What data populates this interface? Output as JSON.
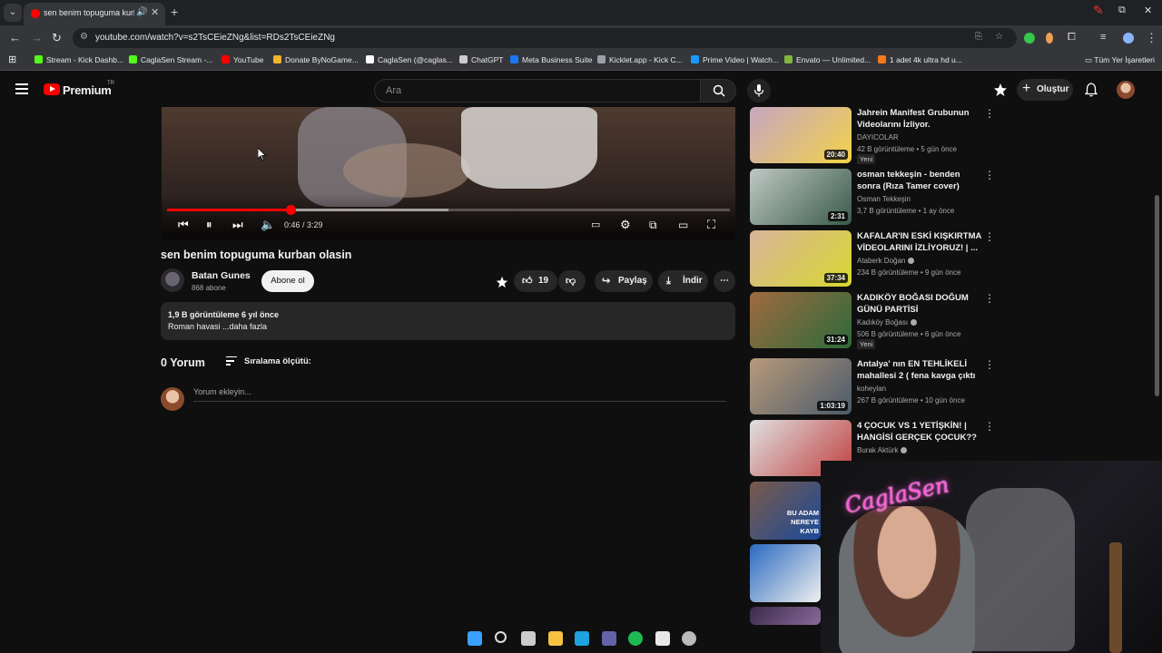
{
  "browser": {
    "tab_title": "sen benim topuguma kurba",
    "url": "youtube.com/watch?v=s2TsCEieZNg&list=RDs2TsCEieZNg",
    "bookmarks": [
      {
        "label": "Stream - Kick Dashb...",
        "color": "#53fc18"
      },
      {
        "label": "CaglaSen Stream -...",
        "color": "#53fc18"
      },
      {
        "label": "YouTube",
        "color": "#ff0000"
      },
      {
        "label": "Donate ByNoGame...",
        "color": "#f0b429"
      },
      {
        "label": "CaglaSen (@caglas...",
        "color": "#ffffff"
      },
      {
        "label": "ChatGPT",
        "color": "#cccccc"
      },
      {
        "label": "Meta Business Suite",
        "color": "#1877f2"
      },
      {
        "label": "Kicklet.app - Kick C...",
        "color": "#9aa0a6"
      },
      {
        "label": "Prime Video | Watch...",
        "color": "#1a98ff"
      },
      {
        "label": "Envato — Unlimited...",
        "color": "#82b541"
      },
      {
        "label": "1 adet 4k ultra hd u...",
        "color": "#f27a1a"
      }
    ],
    "all_bookmarks": "Tüm Yer İşaretleri"
  },
  "header": {
    "logo_text": "Premium",
    "country": "TR",
    "search_placeholder": "Ara",
    "create_label": "Oluştur"
  },
  "player": {
    "time": "0:46 / 3:29",
    "progress": 0.22,
    "buffered": 0.5
  },
  "video": {
    "title": "sen benim topuguma kurban olasin",
    "channel": "Batan Gunes",
    "subscribers": "868 abone",
    "subscribe_label": "Abone ol",
    "likes": "19",
    "share_label": "Paylaş",
    "download_label": "İndir",
    "views_age": "1,9 B görüntüleme  6 yıl önce",
    "description": "Roman havasi ...daha fazla"
  },
  "comments": {
    "count_label": "0 Yorum",
    "sort_label": "Sıralama ölçütü:",
    "placeholder": "Yorum ekleyin..."
  },
  "related": [
    {
      "title": "Jahrein Manifest Grubunun Videolarını İzliyor.",
      "channel": "DAYICOLAR",
      "meta": "42 B görüntüleme • 5 gün önce",
      "duration": "20:40",
      "badge": "Yeni",
      "verified": false,
      "colors": [
        "#c6a6c0",
        "#f2d24a"
      ]
    },
    {
      "title": "osman tekkeşin - benden sonra (Rıza Tamer cover)",
      "channel": "Osman Tekkeşin",
      "meta": "3,7 B görüntüleme • 1 ay önce",
      "duration": "2:31",
      "badge": "",
      "verified": false,
      "colors": [
        "#bfc8c4",
        "#3a5a4a"
      ]
    },
    {
      "title": "KAFALAR'IN ESKİ KIŞKIRTMA VİDEOLARINI İZLİYORUZ! | ...",
      "channel": "Ataberk Doğan",
      "meta": "234 B görüntüleme • 9 gün önce",
      "duration": "37:34",
      "badge": "",
      "verified": true,
      "colors": [
        "#d8b49a",
        "#d8d830"
      ]
    },
    {
      "title": "KADIKÖY BOĞASI DOĞUM GÜNÜ PARTİSİ",
      "channel": "Kadıköy Boğası",
      "meta": "506 B görüntüleme • 6 gün önce",
      "duration": "31:24",
      "badge": "Yeni",
      "verified": true,
      "colors": [
        "#a06a40",
        "#2c6a3a"
      ]
    },
    {
      "title": "Antalya' nın EN TEHLİKELİ mahallesi 2 ( fena kavga çıktı ...",
      "channel": "koheylan",
      "meta": "267 B görüntüleme • 10 gün önce",
      "duration": "1:03:19",
      "badge": "",
      "verified": false,
      "colors": [
        "#b89a7a",
        "#4a5a6a"
      ]
    },
    {
      "title": "4 ÇOCUK VS 1 YETİŞKİN! | HANGİSİ GERÇEK ÇOCUK??",
      "channel": "Burak Aktürk",
      "meta": "",
      "duration": "",
      "badge": "",
      "verified": true,
      "colors": [
        "#e0e0e0",
        "#c04040"
      ]
    }
  ],
  "related_partial": [
    {
      "caption": "BU ADAM NEREYE KAYB",
      "colors": [
        "#7a5a4a",
        "#1a4a9a"
      ]
    },
    {
      "caption": "",
      "colors": [
        "#2a6ac0",
        "#f0f0f0"
      ]
    },
    {
      "caption": "",
      "colors": [
        "#3a2a4a",
        "#8a6a9a"
      ]
    }
  ],
  "webcam": {
    "sign_text": "CaglaSen"
  },
  "taskbar": [
    "windows-icon",
    "search-icon",
    "task-view-icon",
    "explorer-icon",
    "edge-icon",
    "teams-icon",
    "spotify-icon",
    "chrome-icon",
    "obs-icon"
  ]
}
